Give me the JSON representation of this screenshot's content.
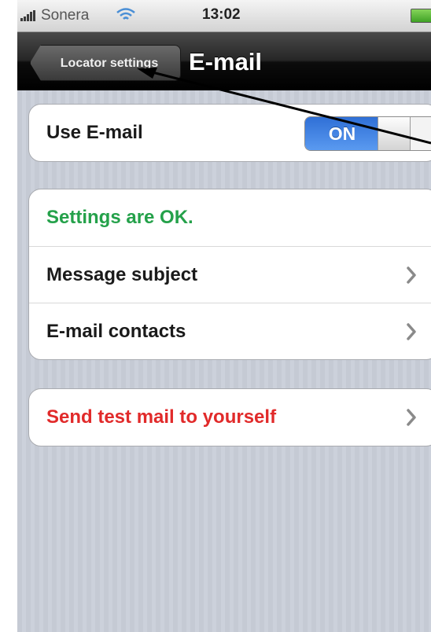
{
  "statusbar": {
    "carrier": "Sonera",
    "time": "13:02"
  },
  "navbar": {
    "back_label": "Locator settings",
    "title": "E-mail"
  },
  "use_email": {
    "label": "Use E-mail",
    "toggle_state": "ON"
  },
  "settings_group": {
    "status": "Settings are OK.",
    "items": [
      {
        "label": "Message subject"
      },
      {
        "label": "E-mail contacts"
      }
    ]
  },
  "test_group": {
    "label": "Send test mail to yourself"
  },
  "colors": {
    "ok_green": "#24a14a",
    "warning_red": "#e12a2a",
    "toggle_blue": "#2f6fd6"
  }
}
